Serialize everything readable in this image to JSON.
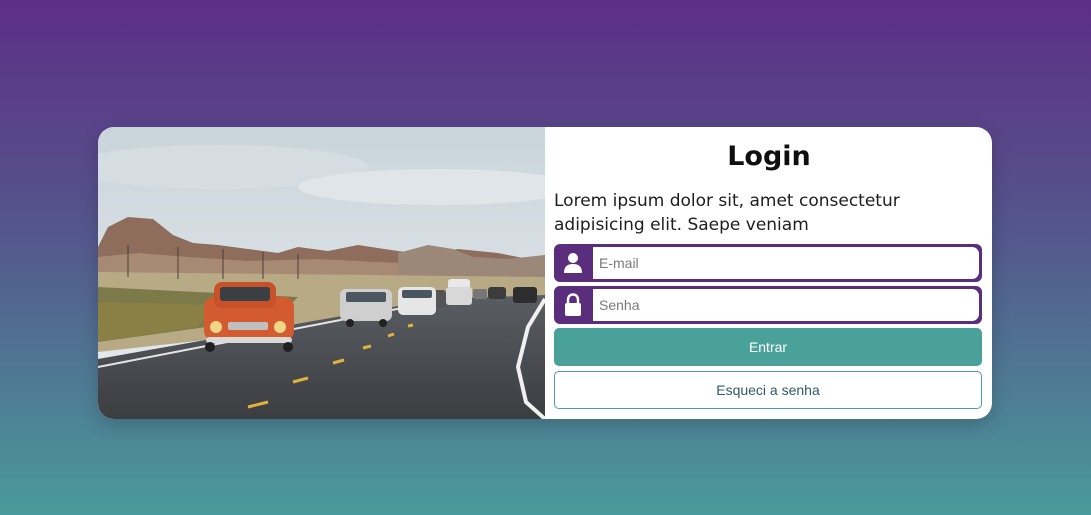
{
  "login": {
    "title": "Login",
    "description": "Lorem ipsum dolor sit, amet consectetur adipisicing elit. Saepe veniam",
    "email": {
      "placeholder": "E-mail",
      "value": "",
      "icon": "user-icon"
    },
    "password": {
      "placeholder": "Senha",
      "value": "",
      "icon": "lock-icon"
    },
    "submit_label": "Entrar",
    "forgot_label": "Esqueci a senha"
  },
  "colors": {
    "bg_top": "#5e2e86",
    "bg_bottom": "#4a9a9b",
    "field_accent": "#5b2d7d",
    "button_primary": "#4aa19a"
  },
  "image": {
    "subject": "vintage red car leading traffic on a desert highway"
  }
}
